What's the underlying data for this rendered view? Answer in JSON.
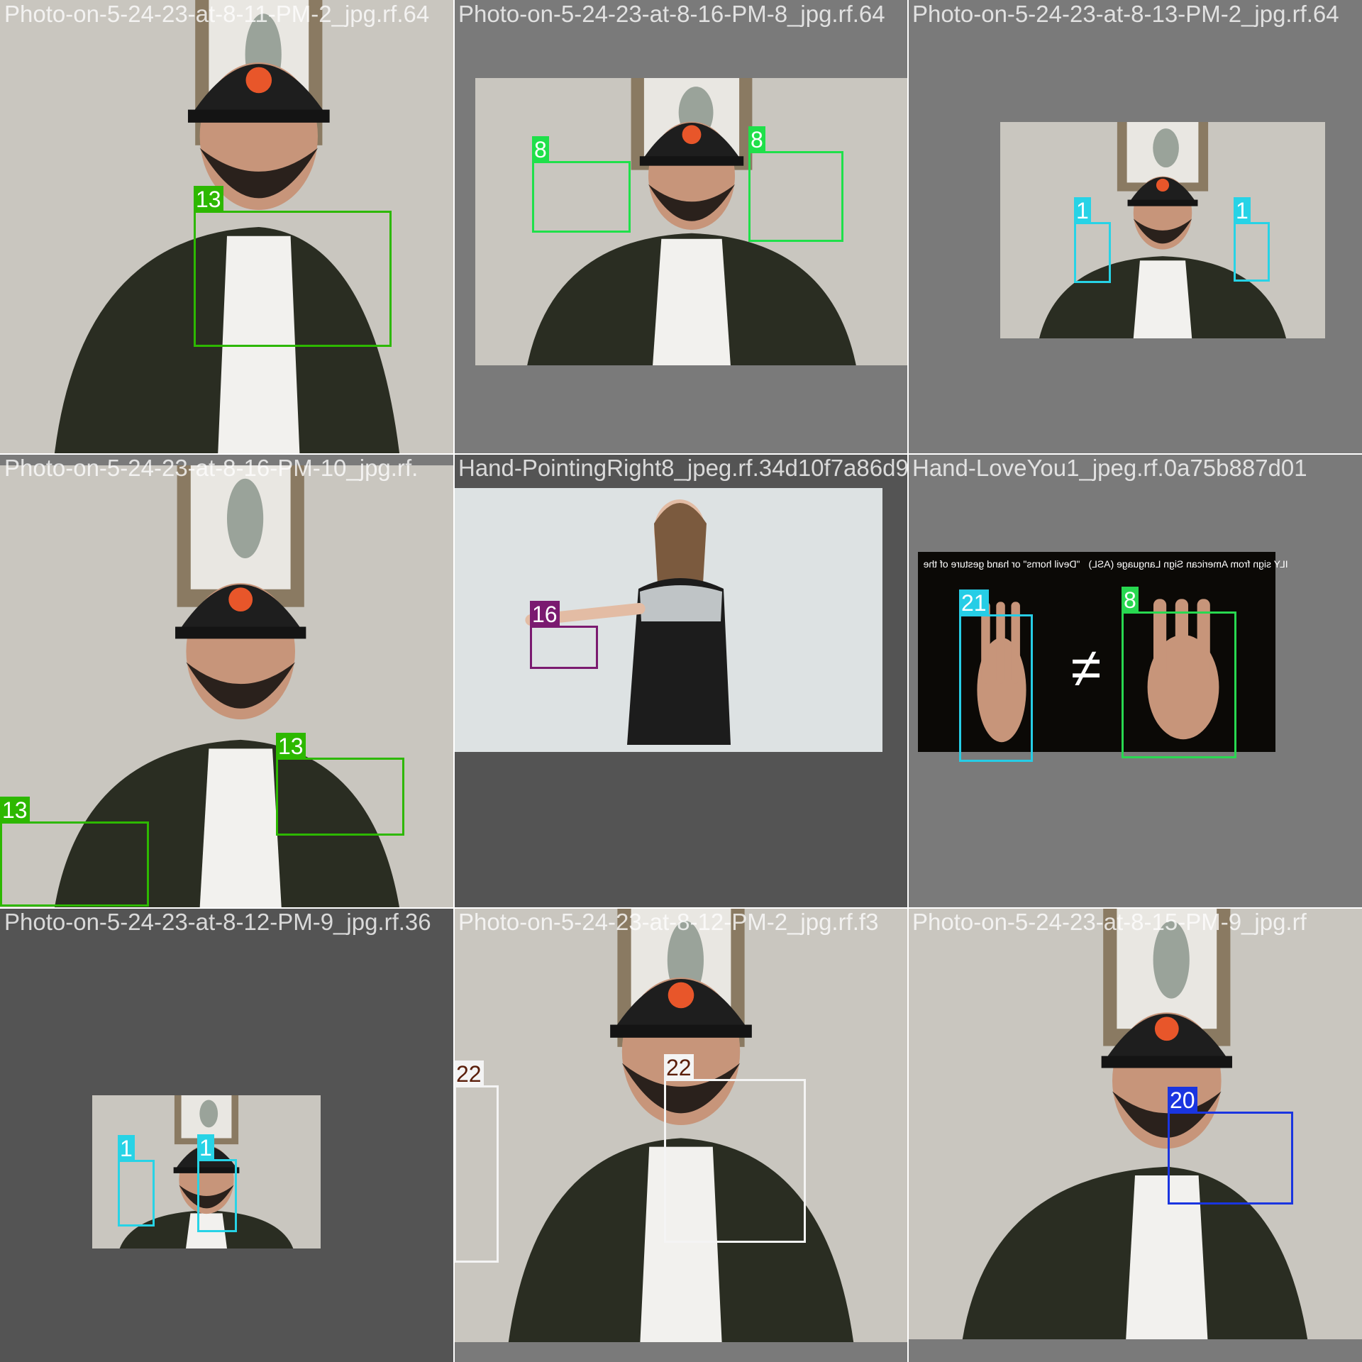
{
  "title": "",
  "tiles": [
    {
      "filename": "Photo-on-5-24-23-at-8-11-PM-2_jpg.rf.64",
      "scene": "man-cap-closeup",
      "detections": [
        {
          "label": "13",
          "color": "#2db800",
          "text_color": "#ffffff"
        }
      ]
    },
    {
      "filename": "Photo-on-5-24-23-at-8-16-PM-8_jpg.rf.64",
      "scene": "man-two-hands",
      "detections": [
        {
          "label": "8",
          "color": "#1fe04a",
          "text_color": "#ffffff"
        },
        {
          "label": "8",
          "color": "#1fe04a",
          "text_color": "#ffffff"
        }
      ]
    },
    {
      "filename": "Photo-on-5-24-23-at-8-13-PM-2_jpg.rf.64",
      "scene": "man-small-fingers",
      "detections": [
        {
          "label": "1",
          "color": "#27d3e6",
          "text_color": "#ffffff"
        },
        {
          "label": "1",
          "color": "#27d3e6",
          "text_color": "#ffffff"
        }
      ]
    },
    {
      "filename": "Photo-on-5-24-23-at-8-16-PM-10_jpg.rf.",
      "scene": "man-crossed-arms",
      "detections": [
        {
          "label": "13",
          "color": "#2db800",
          "text_color": "#ffffff"
        },
        {
          "label": "13",
          "color": "#2db800",
          "text_color": "#ffffff"
        }
      ]
    },
    {
      "filename": "Hand-PointingRight8_jpeg.rf.34d10f7a86d9",
      "scene": "woman-pointing",
      "detections": [
        {
          "label": "16",
          "color": "#7a1a70",
          "text_color": "#ffffff"
        }
      ]
    },
    {
      "filename": "Hand-LoveYou1_jpeg.rf.0a75b887d01",
      "scene": "asl-poster",
      "detections": [
        {
          "label": "21",
          "color": "#26cde6",
          "text_color": "#ffffff"
        },
        {
          "label": "8",
          "color": "#28d850",
          "text_color": "#ffffff"
        }
      ]
    },
    {
      "filename": "Photo-on-5-24-23-at-8-12-PM-9_jpg.rf.36",
      "scene": "man-tiny",
      "detections": [
        {
          "label": "1",
          "color": "#27d3e6",
          "text_color": "#ffffff"
        },
        {
          "label": "1",
          "color": "#27d3e6",
          "text_color": "#ffffff"
        }
      ]
    },
    {
      "filename": "Photo-on-5-24-23-at-8-12-PM-2_jpg.rf.f3",
      "scene": "man-thumbs-down",
      "detections": [
        {
          "label": "22",
          "color": "#f4f4f4",
          "text_color": "#5a1e0a"
        },
        {
          "label": "22",
          "color": "#f4f4f4",
          "text_color": "#5a1e0a"
        }
      ]
    },
    {
      "filename": "Photo-on-5-24-23-at-8-15-PM-9_jpg.rf",
      "scene": "man-fist",
      "detections": [
        {
          "label": "20",
          "color": "#1a35e0",
          "text_color": "#ffffff"
        }
      ]
    }
  ],
  "poster_text": {
    "left": "\"Devil horns\" or hand gesture of the",
    "right": "ILY sign from American Sign Language (ASL)",
    "symbol": "≠"
  },
  "palette": {
    "tile_bg": "#7a7a7a",
    "tile_bg_dark": "#545454",
    "wall": "#c9c6bf",
    "jacket": "#2a2d22",
    "skin": "#c7957a",
    "cap": "#1e1e1e",
    "logo": "#e8562a"
  }
}
